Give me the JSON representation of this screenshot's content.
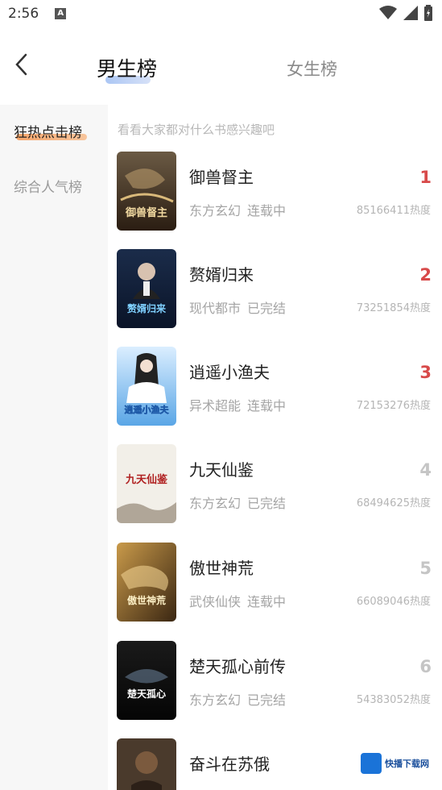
{
  "status": {
    "time": "2:56",
    "notification_letter": "A"
  },
  "tabs": {
    "male": "男生榜",
    "female": "女生榜"
  },
  "sidebar": {
    "items": [
      {
        "label": "狂热点击榜"
      },
      {
        "label": "综合人气榜"
      }
    ]
  },
  "hint": "看看大家都对什么书感兴趣吧",
  "books": [
    {
      "title": "御兽督主",
      "genre": "东方玄幻",
      "status": "连载中",
      "heat": "85166411热度",
      "rank": "1",
      "cover_title": "御兽督主"
    },
    {
      "title": "赘婿归来",
      "genre": "现代都市",
      "status": "已完结",
      "heat": "73251854热度",
      "rank": "2",
      "cover_title": "赘婿归来"
    },
    {
      "title": "逍遥小渔夫",
      "genre": "异术超能",
      "status": "连载中",
      "heat": "72153276热度",
      "rank": "3",
      "cover_title": "逍遥小渔夫"
    },
    {
      "title": "九天仙鉴",
      "genre": "东方玄幻",
      "status": "已完结",
      "heat": "68494625热度",
      "rank": "4",
      "cover_title": "九天仙鉴"
    },
    {
      "title": "傲世神荒",
      "genre": "武侠仙侠",
      "status": "连载中",
      "heat": "66089046热度",
      "rank": "5",
      "cover_title": "傲世神荒"
    },
    {
      "title": "楚天孤心前传",
      "genre": "东方玄幻",
      "status": "已完结",
      "heat": "54383052热度",
      "rank": "6",
      "cover_title": "楚天孤心"
    },
    {
      "title": "奋斗在苏俄",
      "genre": "",
      "status": "",
      "heat": "",
      "rank": "",
      "cover_title": ""
    }
  ],
  "watermark": {
    "text": "快播下载网"
  },
  "colors": {
    "rank_top": "#d84a4a",
    "rank_other": "#c5c5c5",
    "accent_orange": "#f5a56b",
    "accent_blue": "#8fb3f0"
  }
}
